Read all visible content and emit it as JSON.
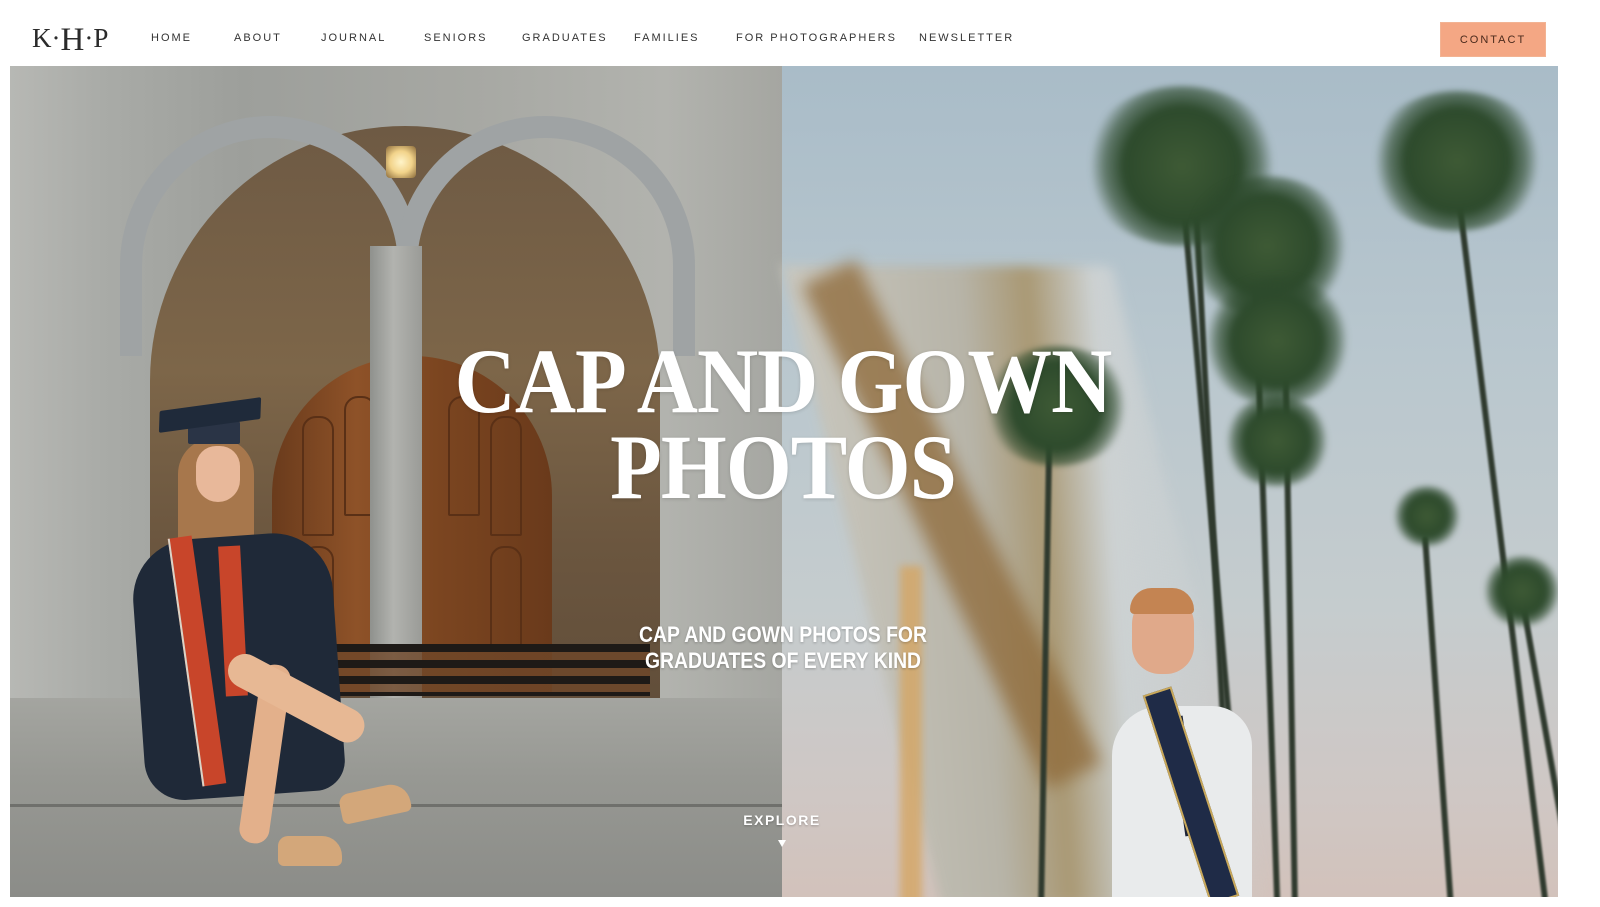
{
  "header": {
    "logo": {
      "left": "K·",
      "center": "H",
      "right": "·P"
    },
    "nav": [
      {
        "label": "HOME"
      },
      {
        "label": "ABOUT"
      },
      {
        "label": "JOURNAL"
      },
      {
        "label": "SENIORS"
      },
      {
        "label": "GRADUATES"
      },
      {
        "label": "FAMILIES"
      },
      {
        "label": "FOR PHOTOGRAPHERS"
      },
      {
        "label": "NEWSLETTER"
      }
    ],
    "contact_label": "CONTACT"
  },
  "hero": {
    "headline_line1": "CAP AND GOWN",
    "headline_line2": "PHOTOS",
    "subhead_line1": "CAP AND GOWN PHOTOS FOR",
    "subhead_line2": "GRADUATES OF EVERY KIND",
    "explore_label": "EXPLORE",
    "explore_icon": "triangle-down-icon",
    "left_photo": "graduate-woman-gothic-arch-photo",
    "right_photo": "graduate-man-palm-trees-photo"
  },
  "colors": {
    "accent": "#f4a784",
    "nav_text": "#333333",
    "hero_text": "#ffffff"
  }
}
